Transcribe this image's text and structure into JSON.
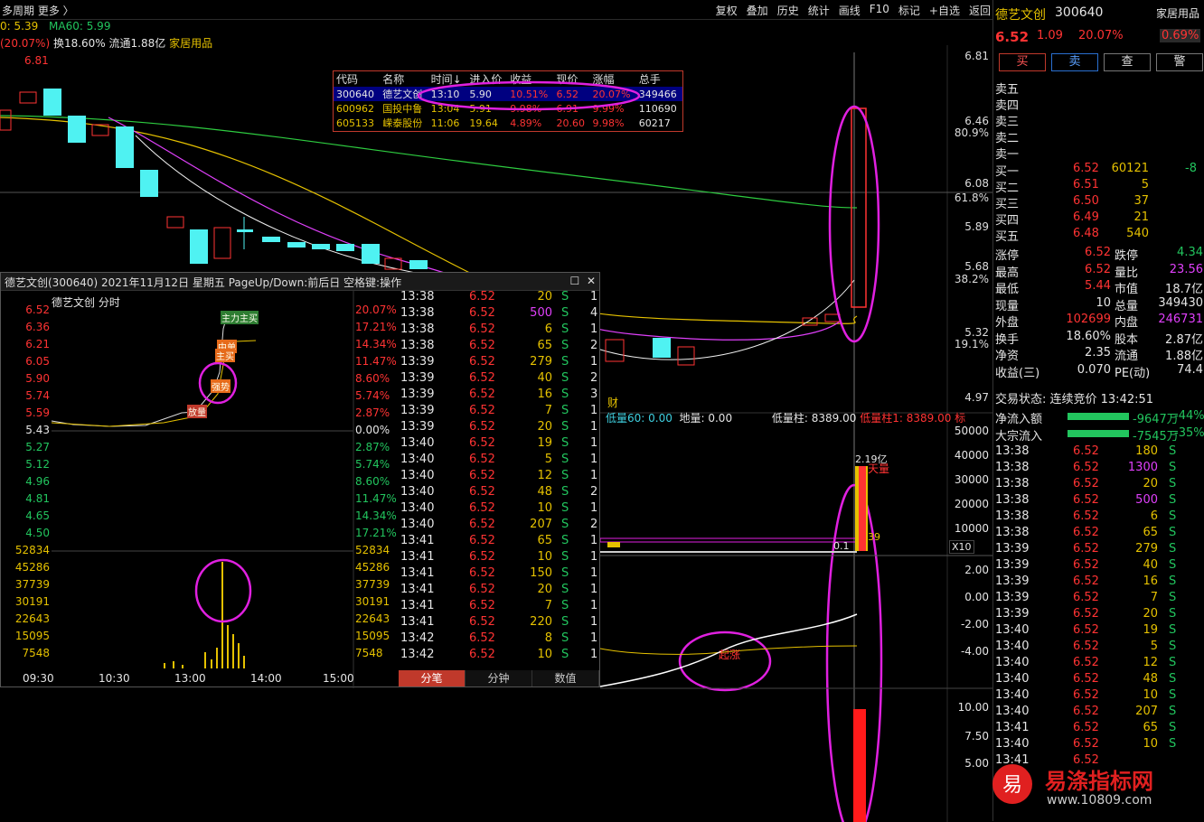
{
  "topbar": {
    "left": "多周期  更多 〉",
    "menu": [
      "复权",
      "叠加",
      "历史",
      "统计",
      "画线",
      "F10",
      "标记",
      "+自选",
      "返回"
    ]
  },
  "ma": {
    "ma_prev": "0: 5.39",
    "ma60": "MA60: 5.99"
  },
  "info2": {
    "chg": "(20.07%)",
    "turnover": "换18.60%",
    "float": "流通1.88亿",
    "industry": "家居用品"
  },
  "kline_annotations": {
    "high_label": "6.81",
    "fin_tag": "财"
  },
  "price_axis": {
    "labels": [
      "6.81",
      "6.46",
      "80.9%",
      "6.08",
      "61.8%",
      "5.89",
      "5.68",
      "38.2%",
      "5.32",
      "19.1%",
      "4.97"
    ]
  },
  "popup": {
    "headers": [
      "代码",
      "名称",
      "时间↓",
      "进入价",
      "收益",
      "现价",
      "涨幅",
      "总手"
    ],
    "rows": [
      [
        "300640",
        "德艺文创",
        "13:10",
        "5.90",
        "10.51%",
        "6.52",
        "20.07%",
        "349466"
      ],
      [
        "600962",
        "国投中鲁",
        "13:04",
        "5.91",
        "9.98%",
        "6.91",
        "9.99%",
        "110690"
      ],
      [
        "605133",
        "嵘泰股份",
        "11:06",
        "19.64",
        "4.89%",
        "20.60",
        "9.98%",
        "60217"
      ]
    ]
  },
  "mini": {
    "title": "德艺文创(300640) 2021年11月12日 星期五 PageUp/Down:前后日 空格键:操作",
    "sub": "德艺文创  分时",
    "left_prices": [
      "6.52",
      "6.36",
      "6.21",
      "6.05",
      "5.90",
      "5.74",
      "5.59",
      "5.43",
      "5.27",
      "5.12",
      "4.96",
      "4.81",
      "4.65",
      "4.50"
    ],
    "right_pct": [
      "20.07%",
      "17.21%",
      "14.34%",
      "11.47%",
      "8.60%",
      "5.74%",
      "2.87%",
      "0.00%",
      "2.87%",
      "5.74%",
      "8.60%",
      "11.47%",
      "14.34%",
      "17.21%"
    ],
    "vol_labels": [
      "52834",
      "45286",
      "37739",
      "30191",
      "22643",
      "15095",
      "7548"
    ],
    "time_labels": [
      "09:30",
      "10:30",
      "13:00",
      "14:00",
      "15:00"
    ],
    "signals": [
      "主力主买",
      "中单",
      "主买",
      "强势",
      "放量"
    ]
  },
  "trades": [
    [
      "13:38",
      "6.52",
      "20",
      "S",
      "1"
    ],
    [
      "13:38",
      "6.52",
      "500",
      "S",
      "4"
    ],
    [
      "13:38",
      "6.52",
      "6",
      "S",
      "1"
    ],
    [
      "13:38",
      "6.52",
      "65",
      "S",
      "2"
    ],
    [
      "13:39",
      "6.52",
      "279",
      "S",
      "1"
    ],
    [
      "13:39",
      "6.52",
      "40",
      "S",
      "2"
    ],
    [
      "13:39",
      "6.52",
      "16",
      "S",
      "3"
    ],
    [
      "13:39",
      "6.52",
      "7",
      "S",
      "1"
    ],
    [
      "13:39",
      "6.52",
      "20",
      "S",
      "1"
    ],
    [
      "13:40",
      "6.52",
      "19",
      "S",
      "1"
    ],
    [
      "13:40",
      "6.52",
      "5",
      "S",
      "1"
    ],
    [
      "13:40",
      "6.52",
      "12",
      "S",
      "1"
    ],
    [
      "13:40",
      "6.52",
      "48",
      "S",
      "2"
    ],
    [
      "13:40",
      "6.52",
      "10",
      "S",
      "1"
    ],
    [
      "13:40",
      "6.52",
      "207",
      "S",
      "2"
    ],
    [
      "13:41",
      "6.52",
      "65",
      "S",
      "1"
    ],
    [
      "13:41",
      "6.52",
      "10",
      "S",
      "1"
    ],
    [
      "13:41",
      "6.52",
      "150",
      "S",
      "1"
    ],
    [
      "13:41",
      "6.52",
      "20",
      "S",
      "1"
    ],
    [
      "13:41",
      "6.52",
      "7",
      "S",
      "1"
    ],
    [
      "13:41",
      "6.52",
      "220",
      "S",
      "1"
    ],
    [
      "13:42",
      "6.52",
      "8",
      "S",
      "1"
    ],
    [
      "13:42",
      "6.52",
      "10",
      "S",
      "1"
    ]
  ],
  "tabs": [
    "分笔",
    "分钟",
    "数值"
  ],
  "vol_panel": {
    "legend_a": "低量60: 0.00",
    "legend_b": "地量: 0.00",
    "legend_c": "低量柱: 8389.00",
    "legend_d": "低量柱1: 8389.00",
    "legend_e": "标",
    "axis": [
      "50000",
      "40000",
      "30000",
      "20000",
      "10000"
    ],
    "x10": "X10",
    "big": "2.19亿",
    "tag": "天量",
    "v39": "39",
    "v01": "0.1"
  },
  "ind_panel": {
    "axis": [
      "2.00",
      "0.00",
      "-2.00",
      "-4.00"
    ],
    "tag": "起涨"
  },
  "bottom_panel": {
    "axis": [
      "10.00",
      "7.50",
      "5.00"
    ]
  },
  "rp": {
    "name": "德艺文创",
    "code": "300640",
    "industry": "家居用品",
    "price": "6.52",
    "chg": "1.09",
    "pct": "20.07%",
    "ind_pct": "0.69%",
    "buttons": [
      "买",
      "卖",
      "查",
      "警"
    ],
    "asks": [
      "卖五",
      "卖四",
      "卖三",
      "卖二",
      "卖一"
    ],
    "bids": [
      [
        "买一",
        "6.52",
        "60121",
        "-8"
      ],
      [
        "买二",
        "6.51",
        "5",
        ""
      ],
      [
        "买三",
        "6.50",
        "37",
        ""
      ],
      [
        "买四",
        "6.49",
        "21",
        ""
      ],
      [
        "买五",
        "6.48",
        "540",
        ""
      ]
    ],
    "stats": [
      [
        "涨停",
        "6.52",
        "跌停",
        "4.34"
      ],
      [
        "最高",
        "6.52",
        "量比",
        "23.56"
      ],
      [
        "最低",
        "5.44",
        "市值",
        "18.7亿"
      ],
      [
        "现量",
        "10",
        "总量",
        "349430"
      ],
      [
        "外盘",
        "102699",
        "内盘",
        "246731"
      ],
      [
        "换手",
        "18.60%",
        "股本",
        "2.87亿"
      ],
      [
        "净资",
        "2.35",
        "流通",
        "1.88亿"
      ],
      [
        "收益(三)",
        "0.070",
        "PE(动)",
        "74.4"
      ]
    ],
    "status": "交易状态: 连续竞价 13:42:51",
    "flow": [
      [
        "净流入额",
        "-9647万",
        "-44%"
      ],
      [
        "大宗流入",
        "-7545万",
        "-35%"
      ]
    ],
    "ticks": [
      [
        "13:38",
        "6.52",
        "180",
        "S"
      ],
      [
        "13:38",
        "6.52",
        "1300",
        "S"
      ],
      [
        "13:38",
        "6.52",
        "20",
        "S"
      ],
      [
        "13:38",
        "6.52",
        "500",
        "S"
      ],
      [
        "13:38",
        "6.52",
        "6",
        "S"
      ],
      [
        "13:38",
        "6.52",
        "65",
        "S"
      ],
      [
        "13:39",
        "6.52",
        "279",
        "S"
      ],
      [
        "13:39",
        "6.52",
        "40",
        "S"
      ],
      [
        "13:39",
        "6.52",
        "16",
        "S"
      ],
      [
        "13:39",
        "6.52",
        "7",
        "S"
      ],
      [
        "13:39",
        "6.52",
        "20",
        "S"
      ],
      [
        "13:40",
        "6.52",
        "19",
        "S"
      ],
      [
        "13:40",
        "6.52",
        "5",
        "S"
      ],
      [
        "13:40",
        "6.52",
        "12",
        "S"
      ],
      [
        "13:40",
        "6.52",
        "48",
        "S"
      ],
      [
        "13:40",
        "6.52",
        "10",
        "S"
      ],
      [
        "13:40",
        "6.52",
        "207",
        "S"
      ],
      [
        "13:41",
        "6.52",
        "65",
        "S"
      ],
      [
        "13:40",
        "6.52",
        "10",
        "S"
      ],
      [
        "13:41",
        "6.52",
        "",
        ""
      ],
      [
        "",
        "6.52",
        "",
        ""
      ],
      [
        "",
        "",
        "207",
        ""
      ],
      [
        "",
        "",
        "65",
        ""
      ]
    ]
  },
  "watermark": {
    "text": "易涤指标网",
    "url": "www.10809.com",
    "logo": "易"
  }
}
